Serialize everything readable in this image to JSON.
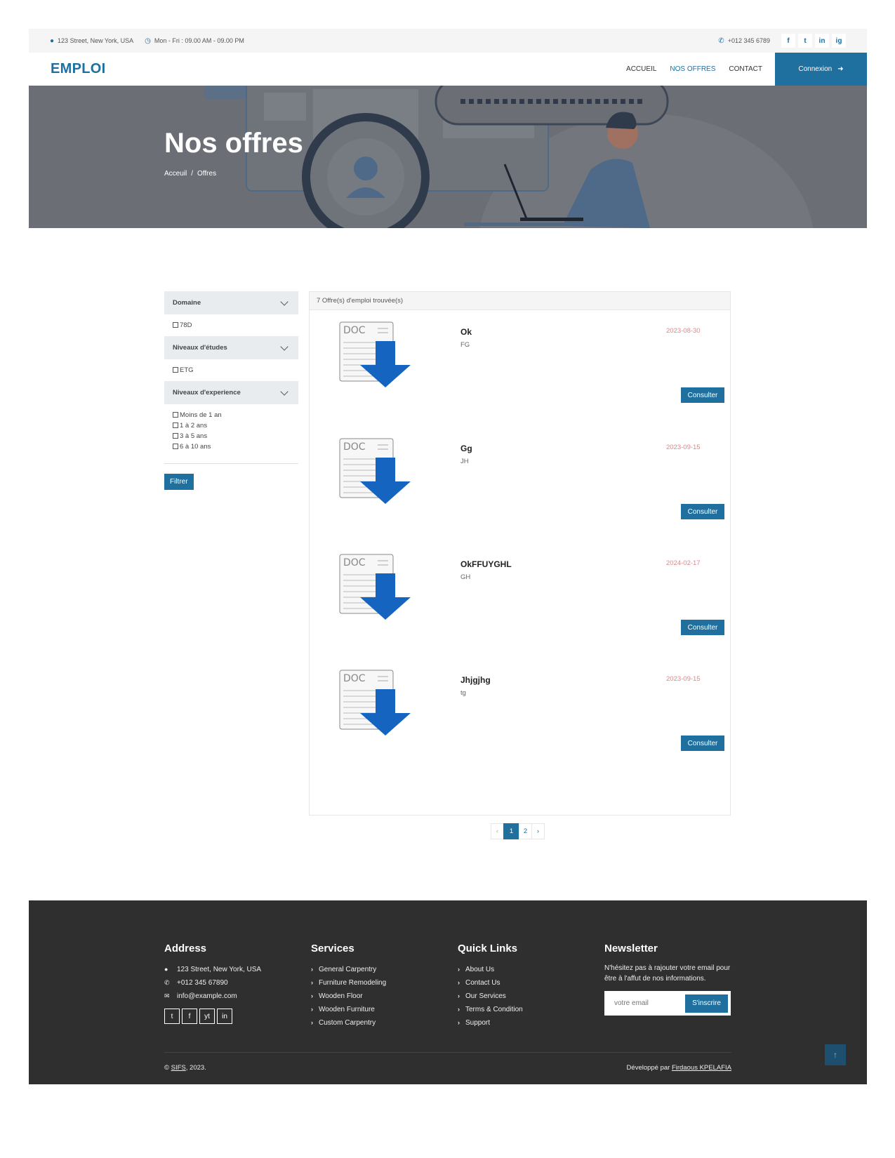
{
  "topbar": {
    "address": "123 Street, New York, USA",
    "hours": "Mon - Fri : 09.00 AM - 09.00 PM",
    "phone": "+012 345 6789",
    "socials": [
      "f",
      "t",
      "in",
      "ig"
    ]
  },
  "nav": {
    "brand": "EMPLOI",
    "links": [
      "ACCUEIL",
      "NOS OFFRES",
      "CONTACT"
    ],
    "active": "NOS OFFRES",
    "cta": "Connexion"
  },
  "hero": {
    "title": "Nos offres",
    "breadcrumb": [
      "Acceuil",
      "/",
      "Offres"
    ]
  },
  "filters": {
    "groups": [
      {
        "title": "Domaine",
        "options": [
          "78D"
        ]
      },
      {
        "title": "Niveaux d'études",
        "options": [
          "ETG"
        ]
      },
      {
        "title": "Niveaux d'experience",
        "options": [
          "Moins de 1 an",
          "1 à 2 ans",
          "3 à 5 ans",
          "6 à 10 ans"
        ]
      }
    ],
    "button": "Filtrer"
  },
  "results": {
    "count_label": "7 Offre(s) d'emploi trouvée(s)",
    "doc_label": "DOC",
    "offers": [
      {
        "title": "Ok",
        "sub": "FG",
        "date": "2023-08-30",
        "button": "Consulter"
      },
      {
        "title": "Gg",
        "sub": "JH",
        "date": "2023-09-15",
        "button": "Consulter"
      },
      {
        "title": "OkFFUYGHL",
        "sub": "GH",
        "date": "2024-02-17",
        "button": "Consulter"
      },
      {
        "title": "Jhjgjhg",
        "sub": "tg",
        "date": "2023-09-15",
        "button": "Consulter"
      }
    ]
  },
  "pagination": {
    "prev": "‹",
    "pages": [
      "1",
      "2"
    ],
    "current": "1",
    "next": "›"
  },
  "footer": {
    "address": {
      "title": "Address",
      "street": "123 Street, New York, USA",
      "phone": "+012 345 67890",
      "email": "info@example.com",
      "socials": [
        "t",
        "f",
        "yt",
        "in"
      ]
    },
    "services": {
      "title": "Services",
      "items": [
        "General Carpentry",
        "Furniture Remodeling",
        "Wooden Floor",
        "Wooden Furniture",
        "Custom Carpentry"
      ]
    },
    "quick_links": {
      "title": "Quick Links",
      "items": [
        "About Us",
        "Contact Us",
        "Our Services",
        "Terms & Condition",
        "Support"
      ]
    },
    "newsletter": {
      "title": "Newsletter",
      "text": "N'hésitez pas à rajouter votre email pour être à l'affut de nos informations.",
      "placeholder": "votre email",
      "button": "S'inscrire"
    },
    "copyright_prefix": "©",
    "copyright_brand": "SIFS",
    "copyright_suffix": ", 2023.",
    "dev_prefix": "Développé par",
    "dev_name": "Firdaous KPELAFIA",
    "back_to_top": "↑"
  },
  "colors": {
    "primary": "#1f6f9f",
    "date": "#d98a8a",
    "footer_bg": "#2f2f2f"
  }
}
